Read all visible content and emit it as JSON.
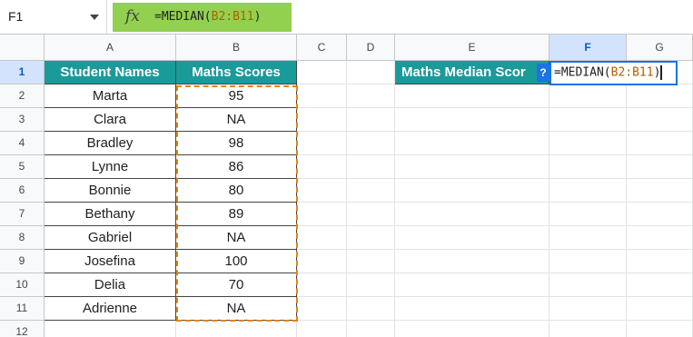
{
  "formula_bar": {
    "cell_ref": "F1",
    "fx_label": "fx",
    "formula_prefix": "=MEDIAN(",
    "formula_range": "B2:B11",
    "formula_suffix": ")"
  },
  "columns": [
    "A",
    "B",
    "C",
    "D",
    "E",
    "F",
    "G"
  ],
  "rows": [
    "1",
    "2",
    "3",
    "4",
    "5",
    "6",
    "7",
    "8",
    "9",
    "10",
    "11",
    "12"
  ],
  "headers": {
    "a1": "Student Names",
    "b1": "Maths Scores",
    "e1": "Maths Median Scor"
  },
  "students": [
    {
      "name": "Marta",
      "score": "95"
    },
    {
      "name": "Clara",
      "score": "NA"
    },
    {
      "name": "Bradley",
      "score": "98"
    },
    {
      "name": "Lynne",
      "score": "86"
    },
    {
      "name": "Bonnie",
      "score": "80"
    },
    {
      "name": "Bethany",
      "score": "89"
    },
    {
      "name": "Gabriel",
      "score": "NA"
    },
    {
      "name": "Josefina",
      "score": "100"
    },
    {
      "name": "Delia",
      "score": "70"
    },
    {
      "name": "Adrienne",
      "score": "NA"
    }
  ],
  "editing_cell": {
    "prefix": "=MEDIAN(",
    "range": "B2:B11",
    "suffix": ")",
    "help_badge": "?"
  },
  "colors": {
    "header_fill": "#1b9a9a",
    "fx_highlight": "#92d050",
    "range_highlight": "#e8830a",
    "active_border": "#1a73e8"
  }
}
